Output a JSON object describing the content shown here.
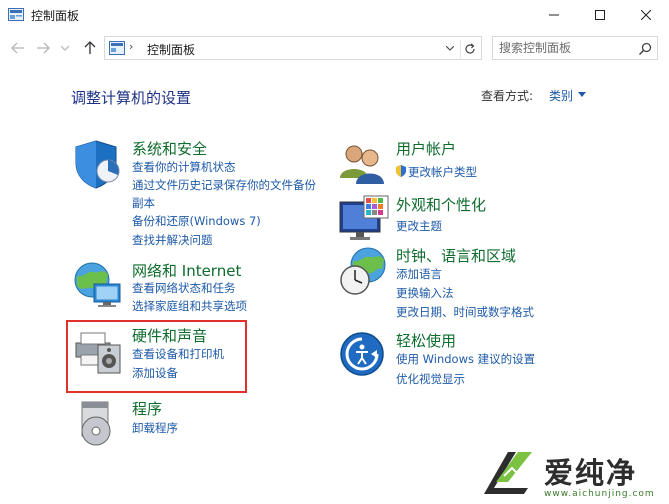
{
  "window": {
    "title": "控制面板"
  },
  "address": {
    "crumb": "控制面板"
  },
  "search": {
    "placeholder": "搜索控制面板"
  },
  "main": {
    "heading": "调整计算机的设置",
    "view_by_label": "查看方式:",
    "view_by_value": "类别"
  },
  "categories": {
    "security": {
      "title": "系统和安全",
      "links": [
        "查看你的计算机状态",
        "通过文件历史记录保存你的文件备份",
        "副本",
        "备份和还原(Windows 7)",
        "查找并解决问题"
      ]
    },
    "network": {
      "title": "网络和 Internet",
      "links": [
        "查看网络状态和任务",
        "选择家庭组和共享选项"
      ]
    },
    "hardware": {
      "title": "硬件和声音",
      "links": [
        "查看设备和打印机",
        "添加设备"
      ]
    },
    "programs": {
      "title": "程序",
      "links": [
        "卸载程序"
      ]
    },
    "accounts": {
      "title": "用户帐户",
      "links": [
        "更改帐户类型"
      ]
    },
    "appearance": {
      "title": "外观和个性化",
      "links": [
        "更改主题"
      ]
    },
    "clock": {
      "title": "时钟、语言和区域",
      "links": [
        "添加语言",
        "更换输入法",
        "更改日期、时间或数字格式"
      ]
    },
    "ease": {
      "title": "轻松使用",
      "links": [
        "使用 Windows 建议的设置",
        "优化视觉显示"
      ]
    }
  },
  "watermark": {
    "text": "爱纯净",
    "url": "www.aichunjing.com"
  },
  "colors": {
    "category_title": "#0e6c2d",
    "link": "#1e5aa8",
    "heading": "#1e3287",
    "highlight_border": "#e0312b"
  }
}
